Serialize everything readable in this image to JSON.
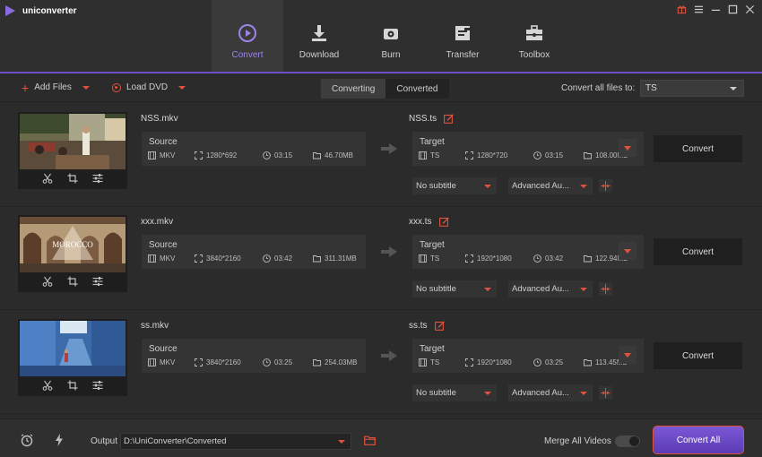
{
  "app": {
    "title": "uniconverter"
  },
  "window_controls": [
    "gift-icon",
    "menu-icon",
    "minimize-icon",
    "maximize-icon",
    "close-icon"
  ],
  "nav": [
    {
      "label": "Convert",
      "icon": "convert-icon",
      "active": true
    },
    {
      "label": "Download",
      "icon": "download-icon",
      "active": false
    },
    {
      "label": "Burn",
      "icon": "burn-icon",
      "active": false
    },
    {
      "label": "Transfer",
      "icon": "transfer-icon",
      "active": false
    },
    {
      "label": "Toolbox",
      "icon": "toolbox-icon",
      "active": false
    }
  ],
  "toolbar": {
    "add_files": "Add Files",
    "load_dvd": "Load DVD",
    "tabs": [
      "Converting",
      "Converted"
    ],
    "active_tab": "Converting",
    "convert_all_label": "Convert all files to:",
    "format": "TS"
  },
  "files": [
    {
      "name": "NSS.mkv",
      "source": {
        "title": "Source",
        "format": "MKV",
        "resolution": "1280*692",
        "duration": "03:15",
        "size": "46.70MB"
      },
      "target_name": "NSS.ts",
      "target": {
        "title": "Target",
        "format": "TS",
        "resolution": "1280*720",
        "duration": "03:15",
        "size": "108.00MB"
      },
      "subtitle": "No subtitle",
      "audio": "Advanced Au...",
      "convert_label": "Convert"
    },
    {
      "name": "xxx.mkv",
      "source": {
        "title": "Source",
        "format": "MKV",
        "resolution": "3840*2160",
        "duration": "03:42",
        "size": "311.31MB"
      },
      "target_name": "xxx.ts",
      "target": {
        "title": "Target",
        "format": "TS",
        "resolution": "1920*1080",
        "duration": "03:42",
        "size": "122.94MB"
      },
      "subtitle": "No subtitle",
      "audio": "Advanced Au...",
      "convert_label": "Convert",
      "thumb_caption": "MOROCCO"
    },
    {
      "name": "ss.mkv",
      "source": {
        "title": "Source",
        "format": "MKV",
        "resolution": "3840*2160",
        "duration": "03:25",
        "size": "254.03MB"
      },
      "target_name": "ss.ts",
      "target": {
        "title": "Target",
        "format": "TS",
        "resolution": "1920*1080",
        "duration": "03:25",
        "size": "113.45MB"
      },
      "subtitle": "No subtitle",
      "audio": "Advanced Au...",
      "convert_label": "Convert"
    }
  ],
  "bottom": {
    "output_label": "Output",
    "output_path": "D:\\UniConverter\\Converted",
    "merge_label": "Merge All Videos",
    "merge_enabled": false,
    "convert_all": "Convert All"
  },
  "colors": {
    "accent": "#7b58d6",
    "highlight": "#e0523c",
    "background": "#2b2b2b"
  }
}
